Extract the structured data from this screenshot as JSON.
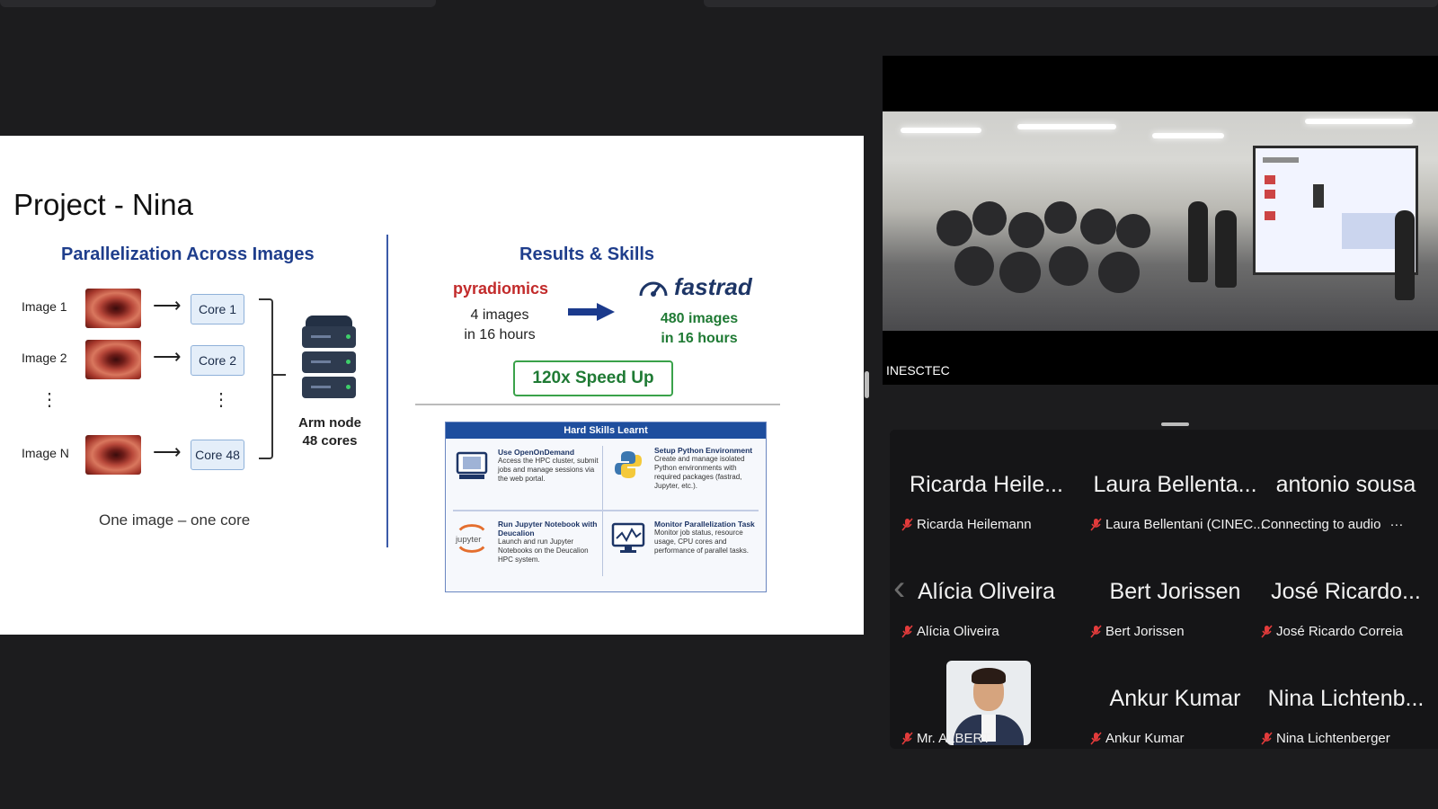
{
  "slide": {
    "title": "Project - Nina",
    "left_section_title": "Parallelization Across Images",
    "right_section_title": "Results & Skills",
    "rows": [
      {
        "image": "Image 1",
        "core": "Core 1"
      },
      {
        "image": "Image 2",
        "core": "Core 2"
      },
      {
        "image": "Image N",
        "core": "Core 48"
      }
    ],
    "vdots": "⋮",
    "arm_node": [
      "Arm node",
      "48 cores"
    ],
    "caption": "One image – one core",
    "before_tool": "pyradiomics",
    "before_stat": [
      "4 images",
      "in 16 hours"
    ],
    "after_tool": "fastrad",
    "after_stat": [
      "480 images",
      "in 16 hours"
    ],
    "speedup": "120x Speed Up",
    "skills_title": "Hard Skills Learnt",
    "skills": [
      {
        "title": "Use OpenOnDemand",
        "desc": "Access the HPC cluster, submit jobs and manage sessions via the web portal.",
        "icon": "monitor-icon"
      },
      {
        "title": "Setup Python Environment",
        "desc": "Create and manage isolated Python environments with required packages (fastrad, Jupyter, etc.).",
        "icon": "python-icon"
      },
      {
        "title": "Run Jupyter Notebook with Deucalion",
        "desc": "Launch and run Jupyter Notebooks on the Deucalion HPC system.",
        "icon": "jupyter-icon"
      },
      {
        "title": "Monitor Parallelization Task",
        "desc": "Monitor job status, resource usage, CPU cores and performance of parallel tasks.",
        "icon": "chart-monitor-icon"
      }
    ],
    "colors": {
      "accent_blue": "#1f3e8c",
      "red": "#c22b2b",
      "green": "#3aa24a"
    }
  },
  "video": {
    "label": "INESCTEC"
  },
  "participants": [
    {
      "display": "Ricarda Heile...",
      "caption": "Ricarda Heilemann",
      "muted": true
    },
    {
      "display": "Laura Bellenta...",
      "caption": "Laura Bellentani (CINEC...",
      "muted": true
    },
    {
      "display": "antonio sousa",
      "caption": "Connecting to audio",
      "muted": false,
      "more": "···"
    },
    {
      "display": "Alícia Oliveira",
      "caption": "Alícia Oliveira",
      "muted": true
    },
    {
      "display": "Bert Jorissen",
      "caption": "Bert Jorissen",
      "muted": true
    },
    {
      "display": "José Ricardo...",
      "caption": "José Ricardo Correia",
      "muted": true
    },
    {
      "display": "",
      "caption": "Mr. ALBERT",
      "muted": true,
      "avatar": true
    },
    {
      "display": "Ankur Kumar",
      "caption": "Ankur Kumar",
      "muted": true
    },
    {
      "display": "Nina Lichtenb...",
      "caption": "Nina Lichtenberger",
      "muted": true
    }
  ],
  "nav": {
    "prev_icon": "‹"
  }
}
